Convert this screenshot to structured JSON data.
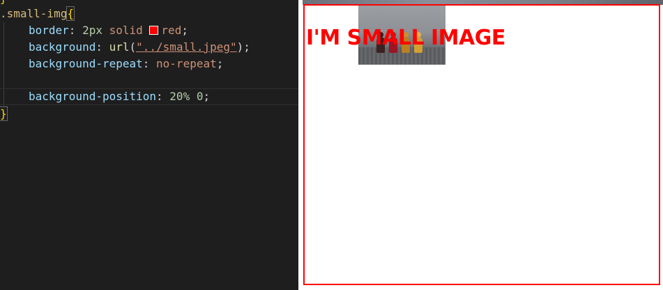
{
  "editor": {
    "top_brace": "}",
    "selector": ".small-img",
    "open_brace": "{",
    "close_brace": "}",
    "declarations": [
      {
        "property": "border",
        "colon": ": ",
        "values": [
          "2px",
          "solid",
          "red"
        ],
        "terminator": ";"
      },
      {
        "property": "background",
        "colon": ": ",
        "fn": "url",
        "arg": "\"../small.jpeg\"",
        "terminator": ";"
      },
      {
        "property": "background-repeat",
        "colon": ": ",
        "values": [
          "no-repeat"
        ],
        "terminator": ";"
      },
      {
        "property": "background-position",
        "colon": ": ",
        "values": [
          "20%",
          "0"
        ],
        "terminator": ";"
      }
    ]
  },
  "colors": {
    "editor_bg": "#1e1e1e",
    "border_red": "#ff0000",
    "swatch_red": "#ff0000"
  },
  "preview": {
    "heading": "I'M SMALL IMAGE",
    "image_icon": "board-game-pawns-photo"
  }
}
